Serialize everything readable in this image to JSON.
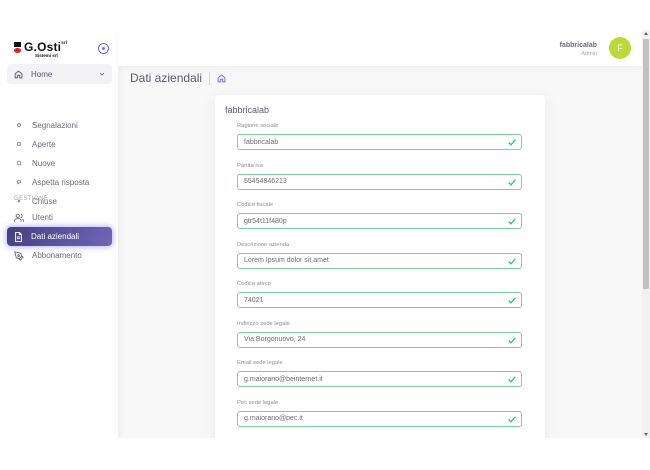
{
  "brand": {
    "name": "G.Osti",
    "name_super": "srl",
    "subtitle": "Sistemi srl",
    "mark_colors": {
      "square": "#111111",
      "dot": "#e02020"
    }
  },
  "sidebar": {
    "home_label": "Home",
    "sub_items": [
      {
        "label": "Segnalazioni",
        "icon": "circle-bullet-icon"
      },
      {
        "label": "Aperte",
        "icon": "square-bullet-icon"
      },
      {
        "label": "Nuove",
        "icon": "file-bullet-icon"
      },
      {
        "label": "Aspetta risposta",
        "icon": "chat-bullet-icon"
      },
      {
        "label": "Chiuse",
        "icon": "x-bullet-icon"
      }
    ],
    "section_title": "GESTIONE",
    "items": [
      {
        "label": "Utenti",
        "icon": "users-icon"
      },
      {
        "label": "Dati aziendali",
        "icon": "document-icon",
        "active": true
      },
      {
        "label": "Abbonamento",
        "icon": "pen-tool-icon"
      }
    ]
  },
  "header": {
    "user_name": "fabbricalab",
    "user_role": "Admin",
    "avatar_initial": "F",
    "avatar_color": "#bcd93a"
  },
  "page": {
    "title": "Dati aziendali"
  },
  "card": {
    "title": "fabbricalab",
    "fields": [
      {
        "label": "Ragione sociale",
        "value": "fabbricalab"
      },
      {
        "label": "Partita iva",
        "value": "55454846213"
      },
      {
        "label": "Codice fiscale",
        "value": "gtr54t11f480p"
      },
      {
        "label": "Descrizione azienda",
        "value": "Lorem Ipsum dolor sit amet"
      },
      {
        "label": "Codice ateco",
        "value": "74021"
      },
      {
        "label": "Indirizzo sede legale",
        "value": "Via Borgonuovo, 24"
      },
      {
        "label": "Email sede legale",
        "value": "g.maiorano@beinternet.it"
      },
      {
        "label": "Pec sede legale",
        "value": "g.maiorano@pec.it"
      }
    ]
  },
  "colors": {
    "accent": "#7367f0",
    "valid": "#28c76f"
  }
}
